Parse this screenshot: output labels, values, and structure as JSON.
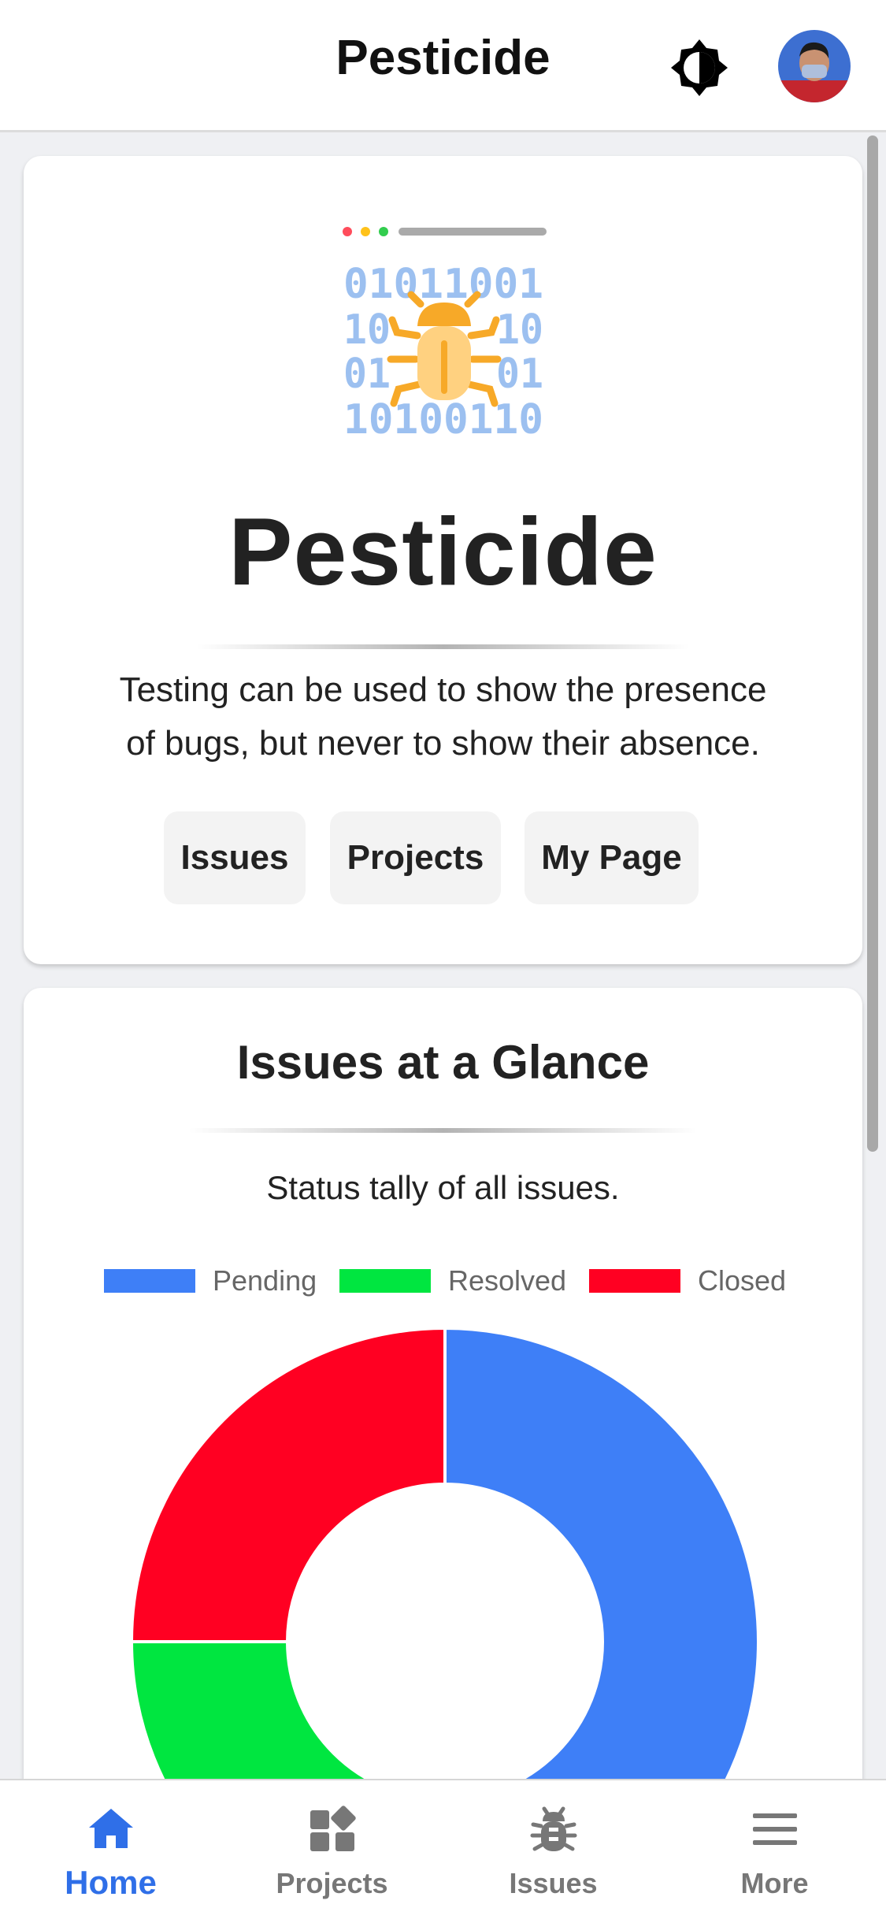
{
  "header": {
    "title": "Pesticide",
    "theme_toggle_icon": "brightness-icon",
    "avatar_icon": "user-avatar"
  },
  "hero": {
    "logo_icon": "bug-binary-icon",
    "logo_binary_rows": [
      "01011001",
      "10",
      "10",
      "01",
      "01",
      "10100110"
    ],
    "title": "Pesticide",
    "quote_line1": "Testing can be used to show the presence",
    "quote_line2": "of bugs, but never to show their absence.",
    "buttons": [
      "Issues",
      "Projects",
      "My Page"
    ]
  },
  "issues_card": {
    "title": "Issues at a Glance",
    "subtitle": "Status tally of all issues.",
    "legend": [
      {
        "label": "Pending",
        "color": "#3e7ff7"
      },
      {
        "label": "Resolved",
        "color": "#00e640"
      },
      {
        "label": "Closed",
        "color": "#ff0022"
      }
    ]
  },
  "chart_data": {
    "type": "pie",
    "style": "doughnut",
    "categories": [
      "Pending",
      "Resolved",
      "Closed"
    ],
    "values": [
      50,
      25,
      25
    ],
    "colors": [
      "#3e7ff7",
      "#00e640",
      "#ff0022"
    ],
    "legend_position": "top"
  },
  "nav": {
    "items": [
      {
        "label": "Home",
        "icon": "home-icon",
        "active": true
      },
      {
        "label": "Projects",
        "icon": "projects-icon",
        "active": false
      },
      {
        "label": "Issues",
        "icon": "bug-icon",
        "active": false
      },
      {
        "label": "More",
        "icon": "menu-icon",
        "active": false
      }
    ],
    "active_color": "#2f6fe8",
    "inactive_color": "#777777"
  }
}
